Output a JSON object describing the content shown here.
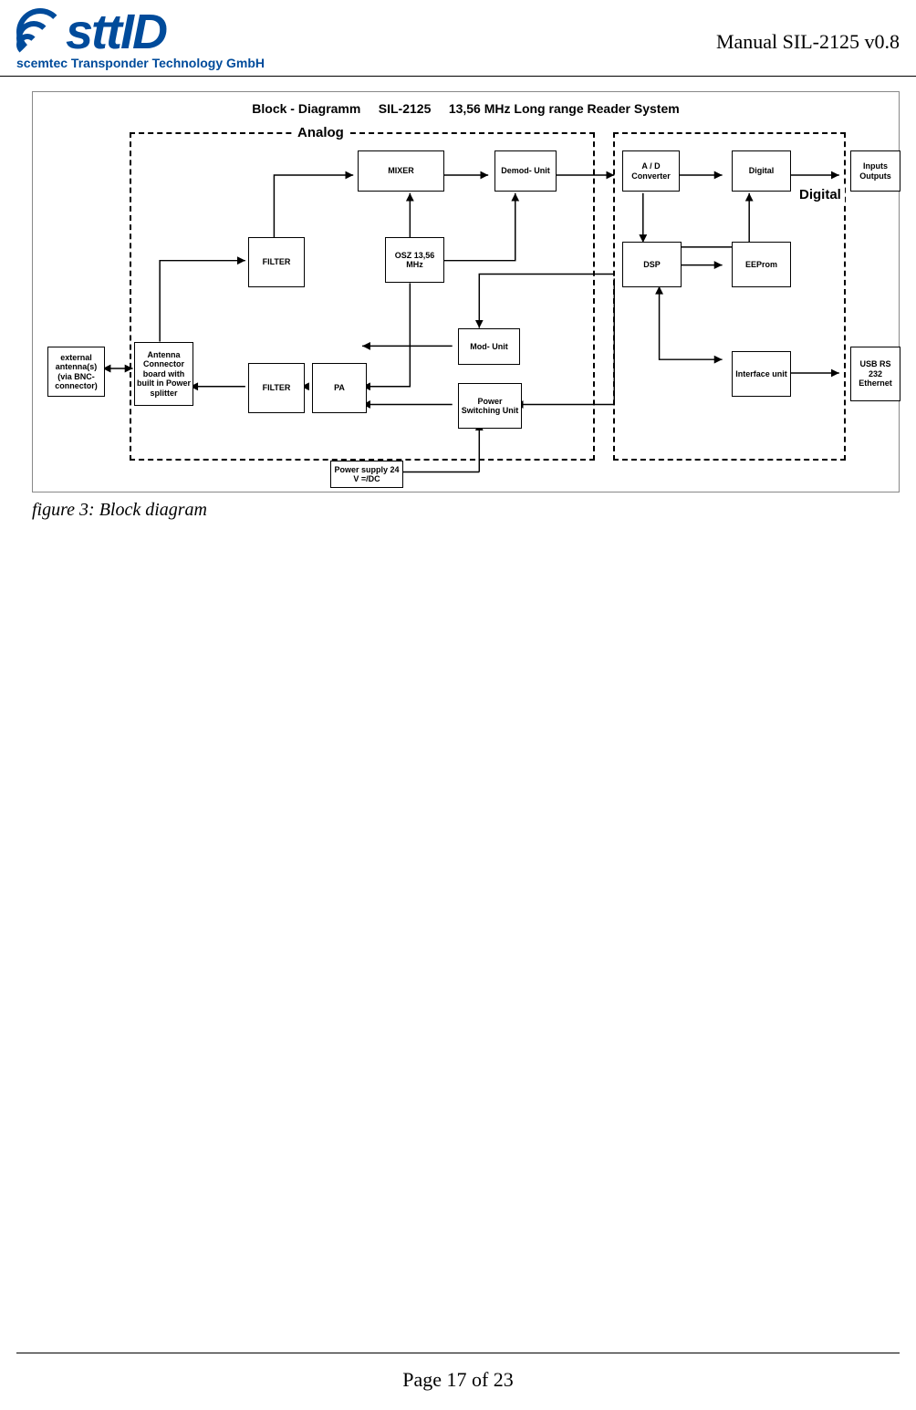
{
  "header": {
    "logo_main_1": "stt",
    "logo_main_2": "ID",
    "logo_sub": "scemtec Transponder Technology GmbH",
    "manual": "Manual SIL-2125 v0.8"
  },
  "diagram": {
    "title": "Block - Diagramm     SIL-2125     13,56 MHz Long range Reader System",
    "analog_label": "Analog",
    "digital_label": "Digital",
    "caption": "figure 3: Block diagram",
    "blocks": {
      "ext": "external antenna(s) (via BNC-connector)",
      "antconn": "Antenna Connector board with built in Power splitter",
      "filter1": "FILTER",
      "filter2": "FILTER",
      "mixer": "MIXER",
      "osz": "OSZ 13,56 MHz",
      "pa": "PA",
      "demod": "Demod- Unit",
      "mod": "Mod- Unit",
      "psu": "Power Switching Unit",
      "supply": "Power supply 24 V =/DC",
      "adc": "A / D Converter",
      "dsp": "DSP",
      "digital": "Digital",
      "eeprom": "EEProm",
      "iface": "Interface unit",
      "io": "Inputs Outputs",
      "comm": "USB RS 232 Ethernet"
    }
  },
  "footer": {
    "page": "Page 17 of 23"
  }
}
